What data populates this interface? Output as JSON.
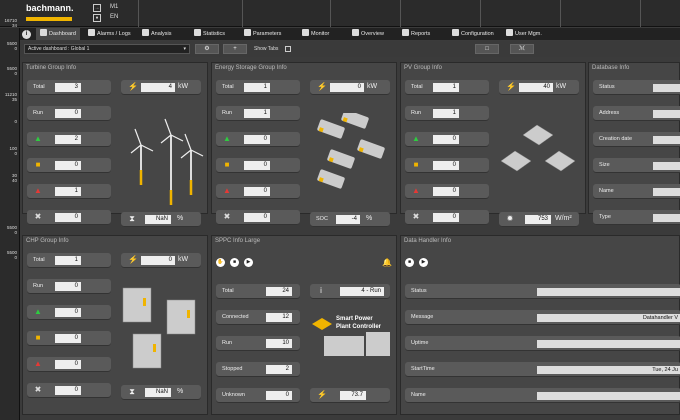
{
  "header": {
    "brand": "bachmann.",
    "unit_m1": "M1",
    "unit_en": "EN"
  },
  "nav": {
    "tabs": [
      {
        "label": "Dashboard"
      },
      {
        "label": "Alarms / Logs"
      },
      {
        "label": "Analysis"
      },
      {
        "label": "Statistics"
      },
      {
        "label": "Parameters"
      },
      {
        "label": "Monitor"
      },
      {
        "label": "Overview"
      },
      {
        "label": "Reports"
      },
      {
        "label": "Configuration"
      },
      {
        "label": "User Mgm."
      }
    ]
  },
  "toolbar": {
    "dashboard_value": "Active dashboard : Global 1",
    "show_tabs": "Show Tabs"
  },
  "rail": [
    {
      "a": "16710",
      "b": "34"
    },
    {
      "a": "5500",
      "b": "0"
    },
    {
      "a": "5500",
      "b": "0"
    },
    {
      "a": "11210",
      "b": "35"
    },
    {
      "a": "0",
      "b": ""
    },
    {
      "a": "100",
      "b": "0"
    },
    {
      "a": "30",
      "b": "40"
    },
    {
      "a": "5500",
      "b": "0"
    },
    {
      "a": "5500",
      "b": "0"
    }
  ],
  "turbine": {
    "title": "Turbine Group Info",
    "total_label": "Total",
    "total": "3",
    "run_label": "Run",
    "run": "0",
    "g1": "2",
    "g2": "0",
    "g3": "1",
    "g4": "0",
    "power": "4",
    "power_unit": "kW",
    "pct": "NaN",
    "pct_unit": "%"
  },
  "energy": {
    "title": "Energy Storage Group Info",
    "total_label": "Total",
    "total": "1",
    "run_label": "Run",
    "run": "1",
    "g1": "0",
    "g2": "0",
    "g3": "0",
    "g4": "0",
    "power": "0",
    "power_unit": "kW",
    "soc_label": "SOC",
    "soc": "-4",
    "soc_unit": "%"
  },
  "pv": {
    "title": "PV Group Info",
    "total_label": "Total",
    "total": "1",
    "run_label": "Run",
    "run": "1",
    "g1": "0",
    "g2": "0",
    "g3": "0",
    "g4": "0",
    "power": "40",
    "power_unit": "kW",
    "irr": "753",
    "irr_unit": "W/m²"
  },
  "database": {
    "title": "Database Info",
    "status": "Status",
    "address": "Address",
    "created": "Creation date",
    "size": "Size",
    "name": "Name",
    "type": "Type"
  },
  "chp": {
    "title": "CHP Group Info",
    "total_label": "Total",
    "total": "1",
    "run_label": "Run",
    "run": "0",
    "g1": "0",
    "g2": "0",
    "g3": "0",
    "g4": "0",
    "power": "0",
    "power_unit": "kW",
    "pct": "NaN",
    "pct_unit": "%"
  },
  "sppc": {
    "title": "SPPC Info Large",
    "total_label": "Total",
    "total": "24",
    "connected_label": "Connected",
    "connected": "12",
    "run_label": "Run",
    "run": "10",
    "stopped_label": "Stopped",
    "stopped": "2",
    "unknown_label": "Unknown",
    "unknown": "0",
    "mode": "4 - Run",
    "value": "73.7",
    "logo_line1": "Smart Power",
    "logo_line2": "Plant Controller"
  },
  "datahandler": {
    "title": "Data Handler Info",
    "status_label": "Status",
    "status": "",
    "message_label": "Message",
    "message": "Datahandler V",
    "uptime_label": "Uptime",
    "uptime": "",
    "starttime_label": "StartTime",
    "starttime": "Tue, 24 Ju",
    "name_label": "Name",
    "name": ""
  },
  "colors": {
    "accent": "#f0b400",
    "green": "#2ecc40",
    "yellow": "#f0b400",
    "red": "#e53935"
  }
}
